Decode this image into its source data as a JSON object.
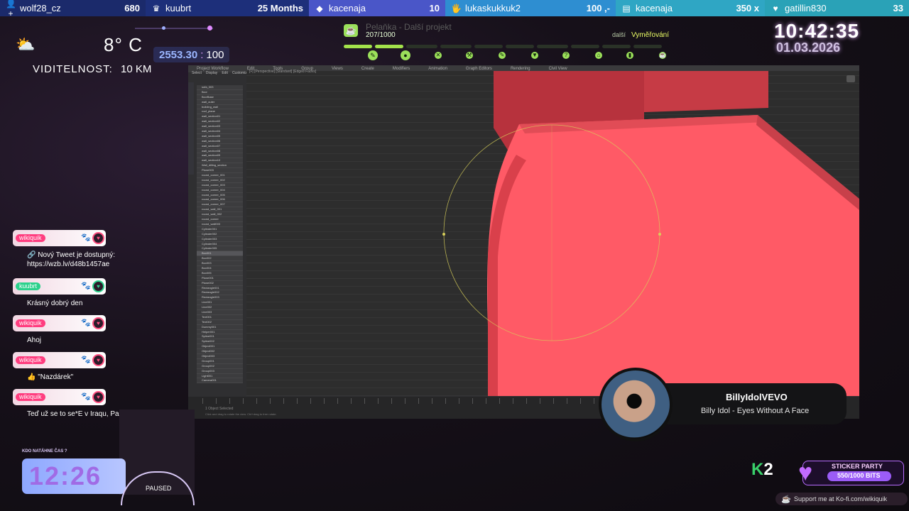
{
  "ticker": [
    {
      "icon": "person-add-icon",
      "glyph": "👤+",
      "name": "wolf28_cz",
      "value": "680",
      "bg": "#1b2a6b"
    },
    {
      "icon": "crown-icon",
      "glyph": "♛",
      "name": "kuubrt",
      "value": "25 Months",
      "bg": "#1d2f7a"
    },
    {
      "icon": "diamond-icon",
      "glyph": "◆",
      "name": "kacenaja",
      "value": "10",
      "bg": "#4a56c8"
    },
    {
      "icon": "gift-icon",
      "glyph": "🖐",
      "name": "lukaskukkuk2",
      "value": "100 ,-",
      "bg": "#2e8ed1"
    },
    {
      "icon": "coin-icon",
      "glyph": "▤",
      "name": "kacenaja",
      "value": "350 x",
      "bg": "#2fa6c4"
    },
    {
      "icon": "heart-hand-icon",
      "glyph": "♥",
      "name": "gatillin830",
      "value": "33",
      "bg": "#2aa2b7"
    }
  ],
  "weather": {
    "temperature": "8° C",
    "visibility_label": "VIDITELNOST:",
    "visibility_value": "10 KM"
  },
  "score": {
    "left": "2553.30",
    "separator": ":",
    "right": "100"
  },
  "goal": {
    "title": "Pelaňka - Další projekt",
    "count": "207/1000",
    "next_label": "další",
    "next_value": "Vyměřování",
    "filled_segments": 2,
    "total_segments": 10
  },
  "clock": {
    "time": "10:42:35",
    "date": "01.03.2026"
  },
  "app": {
    "menu": [
      "Project Workflow",
      "Edit",
      "Tools",
      "Group",
      "Views",
      "Create",
      "Modifiers",
      "Animation",
      "Graph Editors",
      "Rendering",
      "Civil View"
    ],
    "outliner_tabs": [
      "Select",
      "Display",
      "Edit",
      "Customize"
    ],
    "viewport_label": "[+] [Perspective] [Standard] [Edged Faces]",
    "status_line1": "1 Object Selected",
    "status_line2": "Click and drag to rotate the view.  Ctrl+drag to free rotate.",
    "outliner_rows": [
      "sofa_003",
      "floor",
      "floorBase",
      "wall_outer",
      "building_wall",
      "roof_plane",
      "wall_section01",
      "wall_section02",
      "wall_section03",
      "wall_section04",
      "wall_section05",
      "wall_section06",
      "wall_section07",
      "wall_section08",
      "wall_section09",
      "wall_section10",
      "Wall_dilling_section",
      "Plane003",
      "round_corner_001",
      "round_corner_002",
      "round_corner_003",
      "round_corner_004",
      "round_corner_005",
      "round_corner_006",
      "round_corner_007",
      "round_wall_001",
      "round_wall_002",
      "round_corner",
      "round_wall003",
      "Cylinder001",
      "Cylinder002",
      "Cylinder003",
      "Cylinder004",
      "Cylinder005",
      "Box001",
      "Box002",
      "Box003",
      "Box004",
      "Box005",
      "Plane001",
      "Plane002",
      "Rectangle001",
      "Rectangle002",
      "Rectangle003",
      "Line001",
      "Line002",
      "Line003",
      "Text001",
      "Text002",
      "Dummy001",
      "Helper001",
      "Spline001",
      "Spline002",
      "Object001",
      "Object002",
      "Object003",
      "Group001",
      "Group002",
      "Group003",
      "Light001",
      "Camera001",
      "Target001",
      "Mesh001",
      "Mesh002",
      "Mesh003",
      "Mesh004",
      "Mesh005",
      "Mesh006",
      "Mesh007",
      "Mesh008",
      "Mesh009",
      "Mesh010"
    ]
  },
  "chat": [
    {
      "user": "wikiquik",
      "badge_color": "#ff3d7f",
      "lines": [
        "🔗 Nový Tweet je dostupný:",
        "https://wzb.lv/d48b1457ae"
      ]
    },
    {
      "user": "kuubrt",
      "badge_color": "#2bd18c",
      "lines": [
        "Krásný dobrý den"
      ]
    },
    {
      "user": "wikiquik",
      "badge_color": "#ff3d7f",
      "lines": [
        "Ahoj"
      ]
    },
    {
      "user": "wikiquik",
      "badge_color": "#ff3d7f",
      "lines": [
        "👍 \"Nazdárek\""
      ]
    },
    {
      "user": "wikiquik",
      "badge_color": "#ff3d7f",
      "lines": [
        "Teď už se to se*E v Iraqu, Pakistanu"
      ]
    }
  ],
  "timer": {
    "label": "KDO NATÁHNE ČAS ?",
    "value": "12:26",
    "status": "PAUSED"
  },
  "now_playing": {
    "artist": "BillyIdolVEVO",
    "title": "Billy Idol - Eyes Without A Face"
  },
  "k2": {
    "k": "K",
    "n": "2"
  },
  "sticker": {
    "heading": "STICKER PARTY",
    "value": "550/1000 BITS",
    "progress": 0.55
  },
  "kofi": {
    "text": "Support me at Ko-fi.com/wikiquik"
  }
}
